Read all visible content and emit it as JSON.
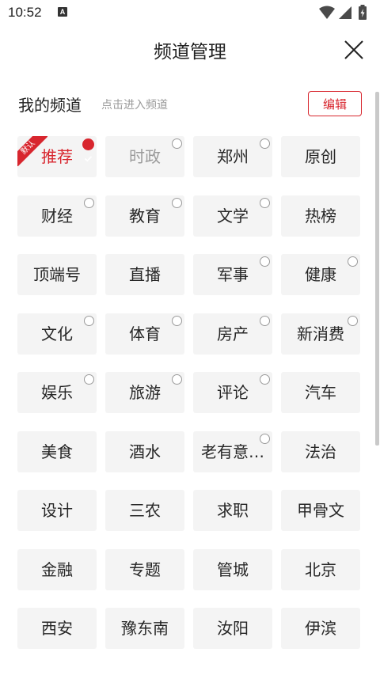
{
  "status_bar": {
    "time": "10:52",
    "notification_glyph": "A",
    "icons": [
      "wifi-icon",
      "signal-icon",
      "battery-charging-icon"
    ]
  },
  "header": {
    "title": "频道管理",
    "close_icon": "close-icon"
  },
  "my_channels": {
    "title": "我的频道",
    "hint": "点击进入频道",
    "edit_label": "编辑"
  },
  "colors": {
    "accent": "#d8262e",
    "chip_bg": "#f4f4f4",
    "muted": "#9a9a9a"
  },
  "channels": [
    {
      "label": "推荐",
      "state": "selected",
      "badge": "默认"
    },
    {
      "label": "时政",
      "state": "disabled",
      "marker": "radio"
    },
    {
      "label": "郑州",
      "state": "normal",
      "marker": "radio"
    },
    {
      "label": "原创",
      "state": "normal"
    },
    {
      "label": "财经",
      "state": "normal",
      "marker": "radio"
    },
    {
      "label": "教育",
      "state": "normal",
      "marker": "radio"
    },
    {
      "label": "文学",
      "state": "normal",
      "marker": "radio"
    },
    {
      "label": "热榜",
      "state": "normal"
    },
    {
      "label": "顶端号",
      "state": "normal"
    },
    {
      "label": "直播",
      "state": "normal"
    },
    {
      "label": "军事",
      "state": "normal",
      "marker": "radio"
    },
    {
      "label": "健康",
      "state": "normal",
      "marker": "radio"
    },
    {
      "label": "文化",
      "state": "normal",
      "marker": "radio"
    },
    {
      "label": "体育",
      "state": "normal",
      "marker": "radio"
    },
    {
      "label": "房产",
      "state": "normal",
      "marker": "radio"
    },
    {
      "label": "新消费",
      "state": "normal",
      "marker": "radio"
    },
    {
      "label": "娱乐",
      "state": "normal",
      "marker": "radio"
    },
    {
      "label": "旅游",
      "state": "normal",
      "marker": "radio"
    },
    {
      "label": "评论",
      "state": "normal",
      "marker": "radio"
    },
    {
      "label": "汽车",
      "state": "normal"
    },
    {
      "label": "美食",
      "state": "normal"
    },
    {
      "label": "酒水",
      "state": "normal"
    },
    {
      "label": "老有意…",
      "state": "normal",
      "marker": "radio"
    },
    {
      "label": "法治",
      "state": "normal"
    },
    {
      "label": "设计",
      "state": "normal"
    },
    {
      "label": "三农",
      "state": "normal"
    },
    {
      "label": "求职",
      "state": "normal"
    },
    {
      "label": "甲骨文",
      "state": "normal"
    },
    {
      "label": "金融",
      "state": "normal"
    },
    {
      "label": "专题",
      "state": "normal"
    },
    {
      "label": "管城",
      "state": "normal"
    },
    {
      "label": "北京",
      "state": "normal"
    },
    {
      "label": "西安",
      "state": "normal"
    },
    {
      "label": "豫东南",
      "state": "normal"
    },
    {
      "label": "汝阳",
      "state": "normal"
    },
    {
      "label": "伊滨",
      "state": "normal"
    }
  ]
}
